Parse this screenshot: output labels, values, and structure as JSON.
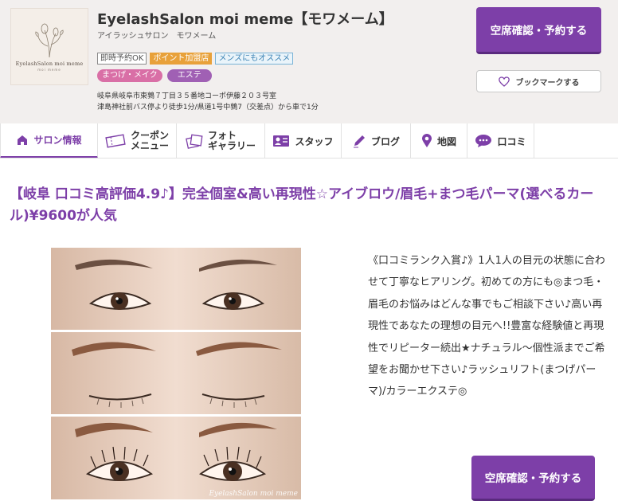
{
  "salon": {
    "name": "EyelashSalon moi meme【モワメーム】",
    "kana": "アイラッシュサロン　モワメーム",
    "logo_text": "EyelashSalon moi meme",
    "logo_sub": "moi meme",
    "badges": [
      "即時予約OK",
      "ポイント加盟店",
      "メンズにもオススメ"
    ],
    "categories": [
      "まつげ・メイク",
      "エステ"
    ],
    "address": "岐阜県岐阜市東鶉７丁目３５番地コーポ伊藤２０３号室",
    "access": "津島神社前バス停より徒歩1分/県道1号中鶉7（交差点）から車で1分"
  },
  "buttons": {
    "reserve": "空席確認・予約する",
    "bookmark": "ブックマークする"
  },
  "tabs": [
    {
      "label": "サロン情報",
      "icon": "home-icon",
      "active": true
    },
    {
      "label": "クーポン\nメニュー",
      "icon": "coupon-icon"
    },
    {
      "label": "フォト\nギャラリー",
      "icon": "photo-icon"
    },
    {
      "label": "スタッフ",
      "icon": "staff-icon"
    },
    {
      "label": "ブログ",
      "icon": "pen-icon"
    },
    {
      "label": "地図",
      "icon": "map-pin-icon"
    },
    {
      "label": "口コミ",
      "icon": "chat-icon"
    }
  ],
  "headline": "【岐阜 口コミ高評価4.9♪】完全個室&高い再現性☆アイブロウ/眉毛+まつ毛パーマ(選べるカール)¥9600が人気",
  "description": "《口コミランク入賞♪》1人1人の目元の状態に合わせて丁寧なヒアリング。初めての方にも◎まつ毛・眉毛のお悩みはどんな事でもご相談下さい♪高い再現性であなたの理想の目元へ!!豊富な経験値と再現性でリピーター続出★ナチュラル〜個性派までご希望をお聞かせ下さい♪ラッシュリフト(まつげパーマ)/カラーエクステ◎",
  "photo_watermark": "EyelashSalon moi meme",
  "colors": {
    "brand_purple": "#7d3fa8",
    "badge_orange": "#e8a13a",
    "pill_pink": "#d96fa6",
    "pill_purple": "#a060b4",
    "header_bg": "#f2efee"
  }
}
